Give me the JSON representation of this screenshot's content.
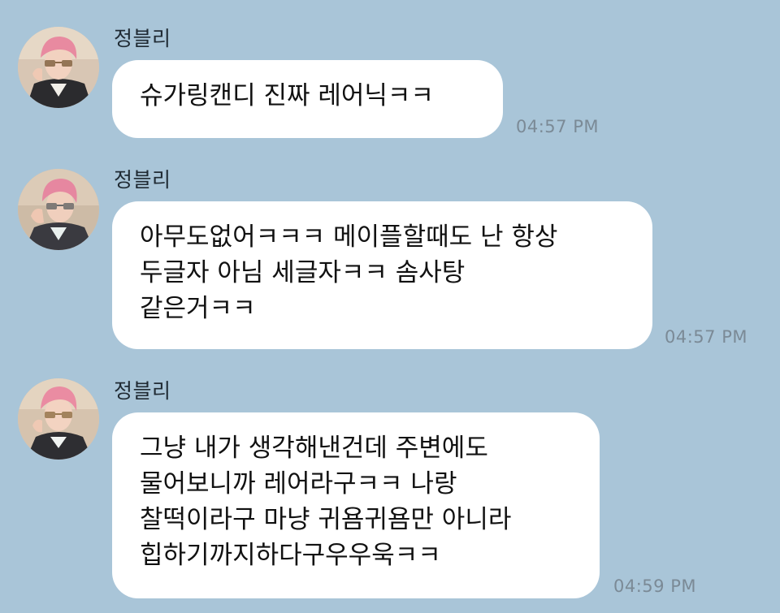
{
  "messages": [
    {
      "sender": "정블리",
      "text": "슈가링캔디 진짜 레어닉ㅋㅋ",
      "time": "04:57 PM"
    },
    {
      "sender": "정블리",
      "text": "아무도없어ㅋㅋㅋ 메이플할때도 난 항상\n두글자 아님 세글자ㅋㅋ 솜사탕\n같은거ㅋㅋ",
      "time": "04:57 PM"
    },
    {
      "sender": "정블리",
      "text": "그냥 내가 생각해낸건데 주변에도\n물어보니까 레어라구ㅋㅋ 나랑\n찰떡이라구 마냥 귀욤귀욤만 아니라\n힙하기까지하다구우우욱ㅋㅋ",
      "time": "04:59 PM"
    }
  ]
}
